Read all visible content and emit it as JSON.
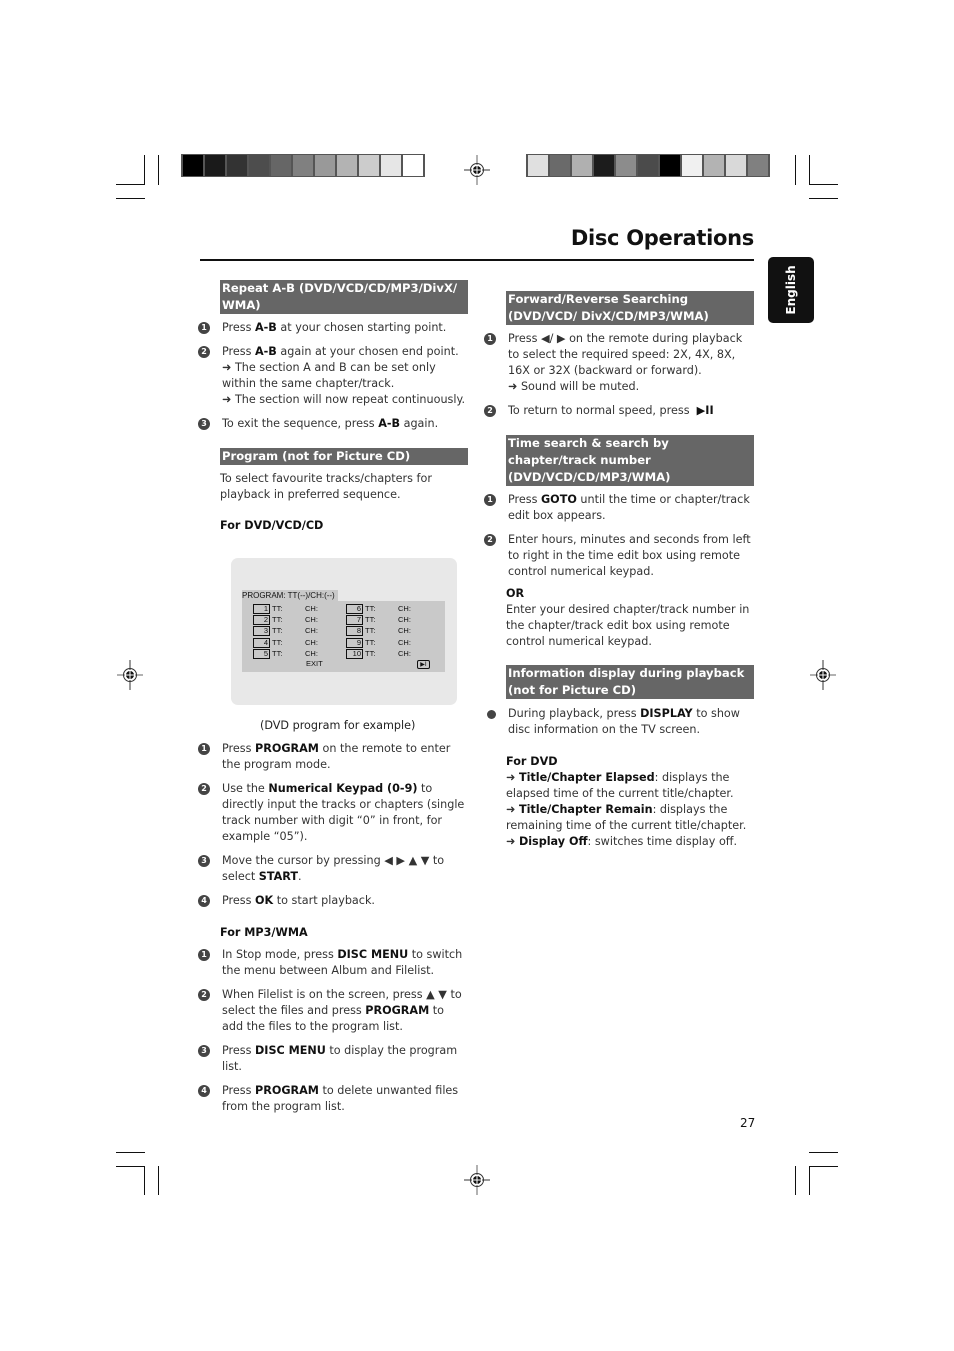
{
  "page": {
    "title": "Disc Operations",
    "language_tab": "English",
    "page_number": "27"
  },
  "color_bars": {
    "left": [
      "#000000",
      "#1a1a1a",
      "#333333",
      "#4d4d4d",
      "#666666",
      "#808080",
      "#999999",
      "#b3b3b3",
      "#cccccc",
      "#e6e6e6",
      "#ffffff"
    ],
    "right": [
      "#e0e0e0",
      "#6a6a6a",
      "#b0b0b0",
      "#1c1c1c",
      "#8c8c8c",
      "#4b4b4b",
      "#000000",
      "#f0f0f0",
      "#b3b3b3",
      "#d9d9d9",
      "#808080"
    ]
  },
  "left_column": {
    "repeat_ab": {
      "header": "Repeat A-B (DVD/VCD/CD/MP3/DivX/ WMA)",
      "steps": [
        {
          "num": "1",
          "pre": "Press ",
          "bold": "A-B",
          "post": " at your chosen starting point."
        },
        {
          "num": "2",
          "pre": "Press ",
          "bold": "A-B",
          "post": " again at your chosen end point.",
          "notes": [
            "The section A and B can be set only within the same chapter/track.",
            "The section will now repeat continuously."
          ]
        },
        {
          "num": "3",
          "pre": "To exit the sequence, press ",
          "bold": "A-B",
          "post": " again."
        }
      ]
    },
    "program": {
      "header": "Program (not for Picture CD)",
      "intro": "To select favourite tracks/chapters for playback in preferred sequence.",
      "dvd_subheader": "For DVD/VCD/CD",
      "osd": {
        "heading": "PROGRAM: TT(--)/CH:(--)",
        "tt_label": "TT:",
        "ch_label": "CH:",
        "slots_left": [
          "1",
          "2",
          "3",
          "4",
          "5"
        ],
        "slots_right": [
          "6",
          "7",
          "8",
          "9",
          "10"
        ],
        "exit_label": "EXIT",
        "start_icon": "play-pause-icon"
      },
      "caption": "(DVD program for example)",
      "dvd_steps": [
        {
          "num": "1",
          "pre": "Press ",
          "bold": "PROGRAM",
          "post": " on the remote to enter the program mode."
        },
        {
          "num": "2",
          "pre": "Use the ",
          "bold": "Numerical Keypad (0-9)",
          "post": " to directly input the tracks or chapters (single track number with digit “0” in front, for example “05”)."
        },
        {
          "num": "3",
          "pre": "Move the cursor by pressing ◀ ▶ ▲ ▼ to select ",
          "bold": "START",
          "post": "."
        },
        {
          "num": "4",
          "pre": "Press ",
          "bold": "OK",
          "post": " to start playback."
        }
      ],
      "mp3_subheader": "For MP3/WMA",
      "mp3_steps": [
        {
          "num": "1",
          "pre": "In Stop mode, press ",
          "bold": "DISC MENU",
          "post": " to switch the menu between Album and Filelist."
        },
        {
          "num": "2",
          "pre": "When Filelist is on the screen, press ▲ ▼ to select the files and press ",
          "bold": "PROGRAM",
          "post": " to add the files to the program list."
        },
        {
          "num": "3",
          "pre": "Press ",
          "bold": "DISC MENU",
          "post": " to display the program list."
        },
        {
          "num": "4",
          "pre": "Press ",
          "bold": "PROGRAM",
          "post": " to delete unwanted files from the program list."
        }
      ]
    }
  },
  "right_column": {
    "fwd_rev": {
      "header": "Forward/Reverse Searching (DVD/VCD/ DivX/CD/MP3/WMA)",
      "steps": [
        {
          "num": "1",
          "text": "Press ◀/ ▶ on the remote during playback to select the required speed: 2X, 4X, 8X, 16X or 32X (backward or forward).",
          "notes": [
            "Sound will be muted."
          ]
        },
        {
          "num": "2",
          "text": "To return to normal speed, press",
          "bold": "▶II"
        }
      ]
    },
    "time_search": {
      "header": "Time search & search by chapter/track number (DVD/VCD/CD/MP3/WMA)",
      "steps": [
        {
          "num": "1",
          "pre": "Press ",
          "bold": "GOTO",
          "post": " until the time or chapter/track edit box appears."
        },
        {
          "num": "2",
          "text": "Enter hours, minutes and seconds from left to right in the time edit box using remote control numerical keypad."
        }
      ],
      "or_label": "OR",
      "or_text": "Enter your desired chapter/track number in the chapter/track edit box using remote control numerical keypad."
    },
    "info_display": {
      "header": "Information display during playback (not for Picture CD)",
      "bullet": {
        "pre": "During playback, press ",
        "bold": "DISPLAY",
        "post": " to show disc information on the TV screen."
      },
      "dvd_subheader": "For DVD",
      "items": [
        {
          "bold": "Title/Chapter Elapsed",
          "post": ": displays the elapsed time of the current title/chapter."
        },
        {
          "bold": "Title/Chapter Remain",
          "post": ": displays the remaining time of the current title/chapter."
        },
        {
          "bold": "Display Off",
          "post": ": switches time display off."
        }
      ]
    }
  }
}
